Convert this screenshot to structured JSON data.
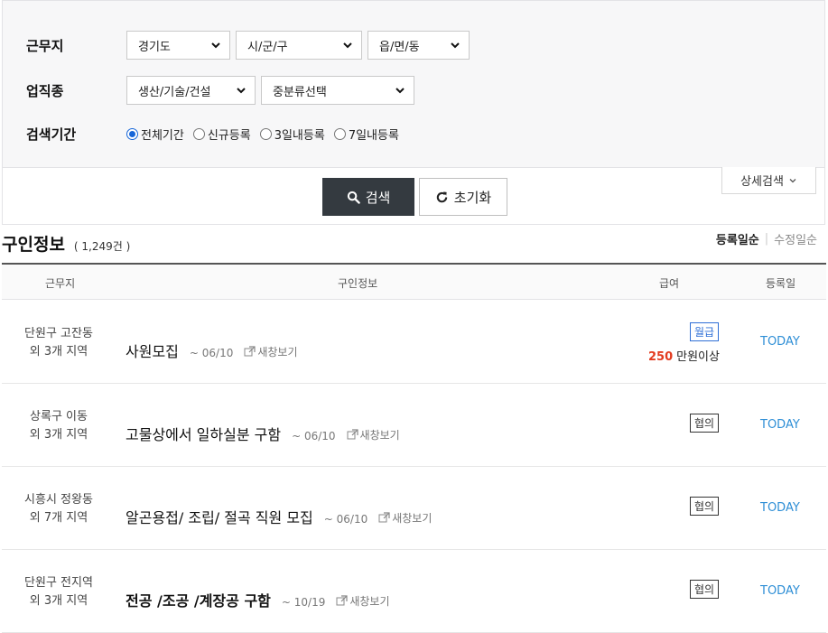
{
  "filters": {
    "work_location_label": "근무지",
    "province": "경기도",
    "city": "시/군/구",
    "district": "읍/면/동",
    "job_type_label": "업직종",
    "job_major": "생산/기술/건설",
    "job_minor": "중분류선택",
    "period_label": "검색기간",
    "period_options": [
      "전체기간",
      "신규등록",
      "3일내등록",
      "7일내등록"
    ],
    "period_selected": "전체기간"
  },
  "buttons": {
    "search": "검색",
    "reset": "초기화",
    "detail_search": "상세검색"
  },
  "section": {
    "title": "구인정보",
    "count": "( 1,249건 )",
    "sort_active": "등록일순",
    "sort_inactive": "수정일순"
  },
  "table": {
    "headers": [
      "근무지",
      "구인정보",
      "급여",
      "등록일"
    ],
    "rows": [
      {
        "loc1": "단원구 고잔동",
        "loc2": "외 3개 지역",
        "title": "사원모집",
        "deadline": "~ 06/10",
        "newwin": "새창보기",
        "pay_type": "월급",
        "pay_num": "250",
        "pay_unit": "만원이상",
        "date": "TODAY"
      },
      {
        "loc1": "상록구 이동",
        "loc2": "외 3개 지역",
        "title": "고물상에서 일하실분 구함",
        "deadline": "~ 06/10",
        "newwin": "새창보기",
        "pay_type": "협의",
        "date": "TODAY"
      },
      {
        "loc1": "시흥시 정왕동",
        "loc2": "외 7개 지역",
        "title": "알곤용접/ 조립/ 절곡 직원 모집",
        "deadline": "~ 06/10",
        "newwin": "새창보기",
        "pay_type": "협의",
        "date": "TODAY"
      },
      {
        "loc1": "단원구 전지역",
        "loc2": "외 3개 지역",
        "title": "전공 /조공 /계장공 구함",
        "deadline": "~ 10/19",
        "newwin": "새창보기",
        "pay_type": "협의",
        "date": "TODAY"
      }
    ]
  },
  "colors": {
    "accent_blue": "#2f6fd6",
    "pay_red": "#e33b1f",
    "dark_button": "#343a40"
  }
}
